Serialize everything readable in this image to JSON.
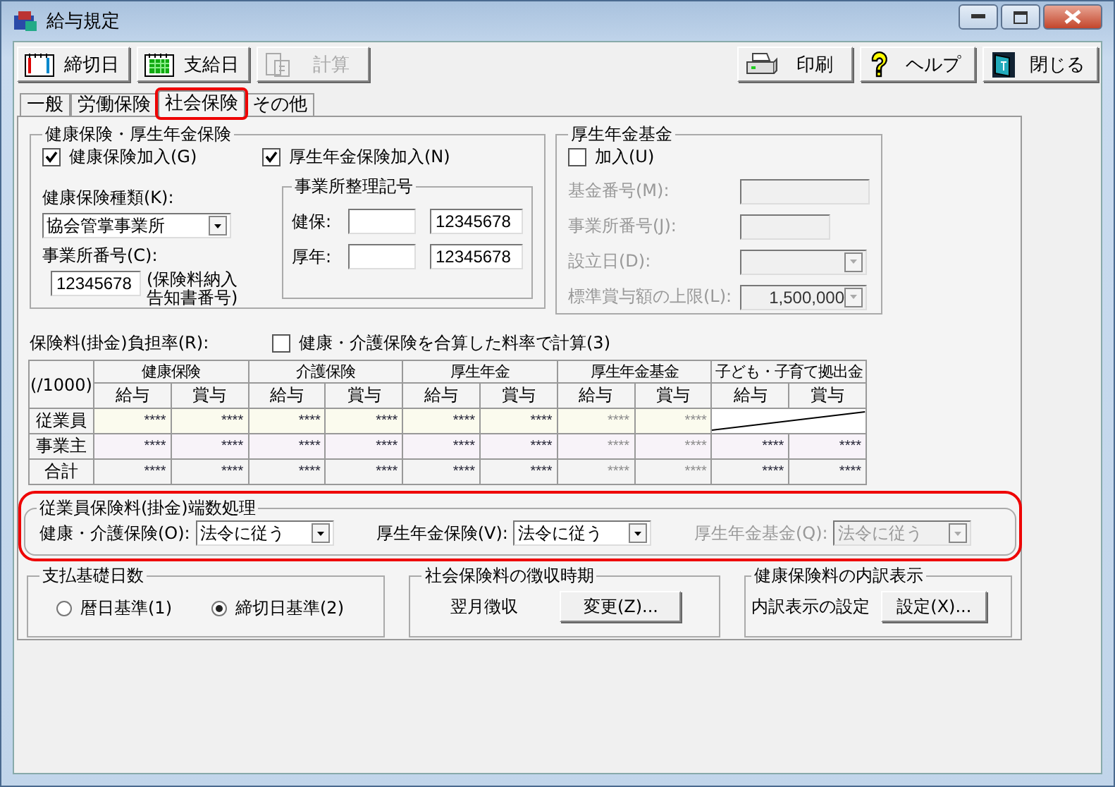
{
  "window": {
    "title": "給与規定"
  },
  "toolbar_left": [
    {
      "label": "締切日",
      "kind": "deadline",
      "disabled": false
    },
    {
      "label": "支給日",
      "kind": "payday",
      "disabled": false
    },
    {
      "label": "計算",
      "kind": "calc",
      "disabled": true
    }
  ],
  "toolbar_right": [
    {
      "label": "印刷",
      "kind": "print"
    },
    {
      "label": "ヘルプ",
      "kind": "help"
    },
    {
      "label": "閉じる",
      "kind": "exit"
    }
  ],
  "tabs": [
    {
      "label": "一般",
      "selected": false,
      "highlighted": false
    },
    {
      "label": "労働保険",
      "selected": false,
      "highlighted": false
    },
    {
      "label": "社会保険",
      "selected": true,
      "highlighted": true
    },
    {
      "label": "その他",
      "selected": false,
      "highlighted": false
    }
  ],
  "health_pension": {
    "title": "健康保険・厚生年金保険",
    "checkboxes": [
      {
        "label": "健康保険加入(G)",
        "checked": true
      },
      {
        "label": "厚生年金保険加入(N)",
        "checked": true
      }
    ],
    "insurance_type": {
      "label": "健康保険種類(K):",
      "value": "協会管掌事業所"
    },
    "office_number": {
      "label": "事業所番号(C):",
      "value": "12345678",
      "note": [
        "(保険料納入",
        "告知書番号)"
      ]
    },
    "registry": {
      "title": "事業所整理記号",
      "rows": [
        {
          "label": "健保:",
          "code": "12345678"
        },
        {
          "label": "厚年:",
          "code": "12345678"
        }
      ]
    }
  },
  "pension_fund": {
    "title": "厚生年金基金",
    "join": {
      "label": "加入(U)",
      "checked": false
    },
    "fields": [
      {
        "label": "基金番号(M):",
        "kind": "text",
        "disabled": true
      },
      {
        "label": "事業所番号(J):",
        "kind": "short",
        "disabled": true
      },
      {
        "label": "設立日(D):",
        "kind": "select",
        "disabled": true
      },
      {
        "label": "標準賞与額の上限(L):",
        "kind": "select",
        "value": "1,500,000",
        "disabled": true
      }
    ]
  },
  "rates": {
    "label": "保険料(掛金)負担率(R):",
    "combine": {
      "label": "健康・介護保険を合算した料率で計算(3)",
      "checked": false
    },
    "unit": "(/1000)",
    "groups": [
      {
        "label": "健康保険"
      },
      {
        "label": "介護保険"
      },
      {
        "label": "厚生年金"
      },
      {
        "label": "厚生年金基金"
      },
      {
        "label": "子ども・子育て拠出金"
      }
    ],
    "subheaders": [
      "給与",
      "賞与",
      "給与",
      "賞与",
      "給与",
      "賞与",
      "給与",
      "賞与",
      "給与",
      "賞与"
    ],
    "rows": [
      {
        "label": "従業員",
        "kind": "employee",
        "cells": [
          {
            "value": "****",
            "disabled": false
          },
          {
            "value": "****",
            "disabled": false
          },
          {
            "value": "****",
            "disabled": false
          },
          {
            "value": "****",
            "disabled": false
          },
          {
            "value": "****",
            "disabled": false
          },
          {
            "value": "****",
            "disabled": false
          },
          {
            "value": "****",
            "disabled": true
          },
          {
            "value": "****",
            "disabled": true
          },
          {
            "kind": "slash"
          }
        ]
      },
      {
        "label": "事業主",
        "kind": "employer",
        "cells": [
          {
            "value": "****",
            "disabled": false
          },
          {
            "value": "****",
            "disabled": false
          },
          {
            "value": "****",
            "disabled": false
          },
          {
            "value": "****",
            "disabled": false
          },
          {
            "value": "****",
            "disabled": false
          },
          {
            "value": "****",
            "disabled": false
          },
          {
            "value": "****",
            "disabled": true
          },
          {
            "value": "****",
            "disabled": true
          },
          {
            "value": "****",
            "disabled": false
          },
          {
            "value": "****",
            "disabled": false
          }
        ]
      },
      {
        "label": "合計",
        "kind": "total",
        "cells": [
          {
            "value": "****",
            "disabled": false
          },
          {
            "value": "****",
            "disabled": false
          },
          {
            "value": "****",
            "disabled": false
          },
          {
            "value": "****",
            "disabled": false
          },
          {
            "value": "****",
            "disabled": false
          },
          {
            "value": "****",
            "disabled": false
          },
          {
            "value": "****",
            "disabled": true
          },
          {
            "value": "****",
            "disabled": true
          },
          {
            "value": "****",
            "disabled": false
          },
          {
            "value": "****",
            "disabled": false
          }
        ]
      }
    ]
  },
  "rounding": {
    "title": "従業員保険料(掛金)端数処理",
    "highlighted": true,
    "fields": [
      {
        "label": "健康・介護保険(O):",
        "value": "法令に従う",
        "disabled": false
      },
      {
        "label": "厚生年金保険(V):",
        "value": "法令に従う",
        "disabled": false
      },
      {
        "label": "厚生年金基金(Q):",
        "value": "法令に従う",
        "disabled": true
      }
    ]
  },
  "payment_days": {
    "title": "支払基礎日数",
    "options": [
      {
        "label": "暦日基準(1)",
        "selected": false
      },
      {
        "label": "締切日基準(2)",
        "selected": true
      }
    ]
  },
  "collection": {
    "title": "社会保険料の徴収時期",
    "text": "翌月徴収",
    "button": "変更(Z)..."
  },
  "breakdown": {
    "title": "健康保険料の内訳表示",
    "text": "内訳表示の設定",
    "button": "設定(X)..."
  }
}
